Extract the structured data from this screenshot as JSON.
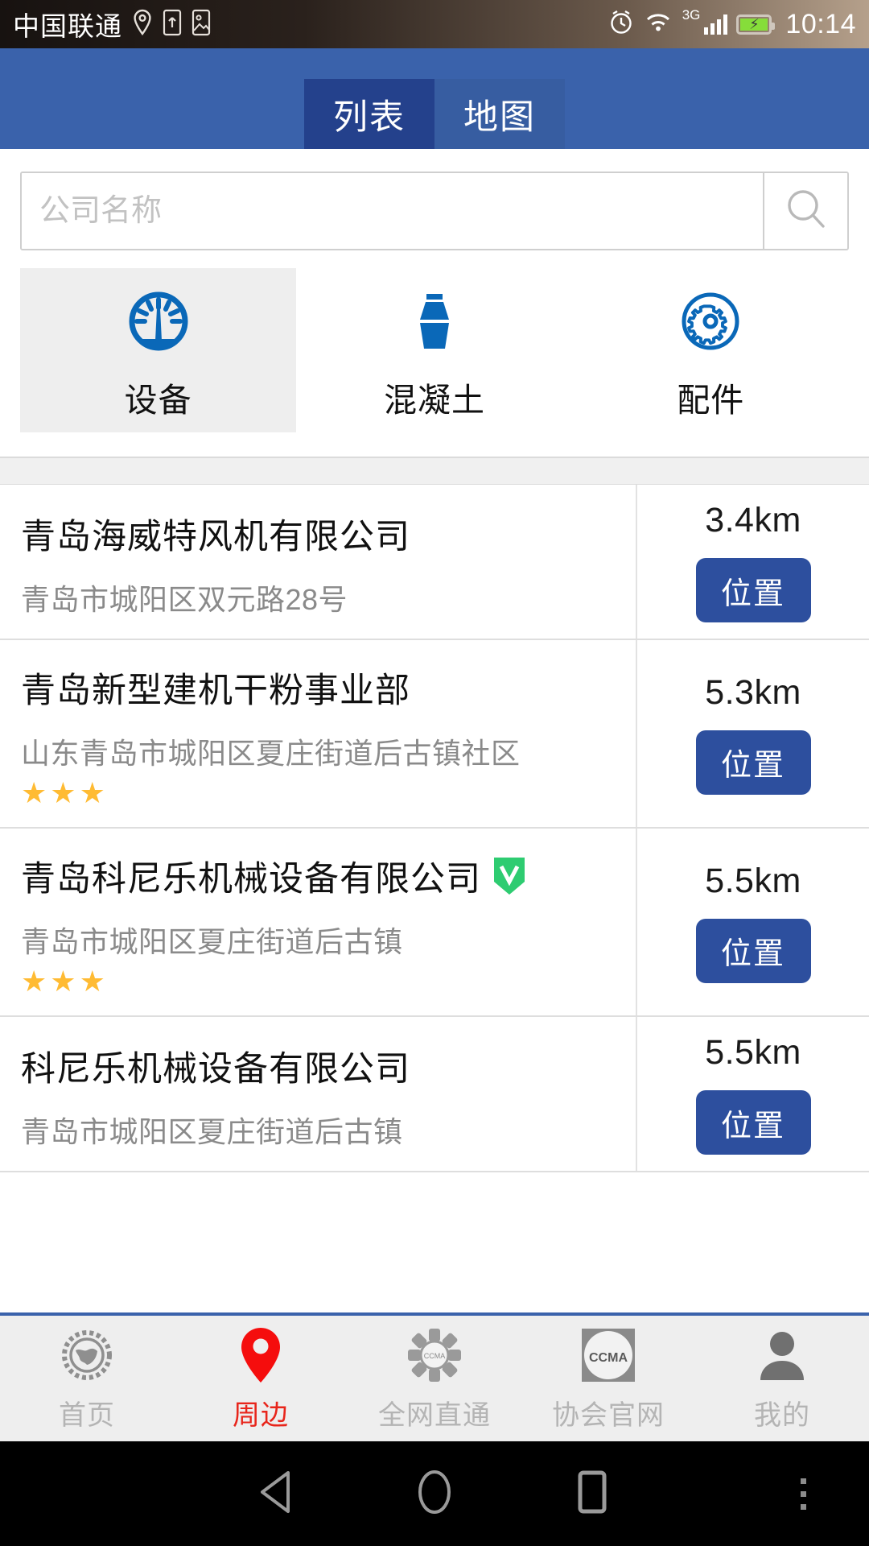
{
  "statusbar": {
    "carrier": "中国联通",
    "network": "3G",
    "time": "10:14",
    "icons": [
      "location-icon",
      "sim-icon",
      "image-icon",
      "alarm-icon",
      "wifi-icon",
      "signal-icon",
      "battery-charging-icon"
    ]
  },
  "header": {
    "tabs": [
      {
        "label": "列表",
        "selected": true
      },
      {
        "label": "地图",
        "selected": false
      }
    ]
  },
  "search": {
    "placeholder": "公司名称",
    "value": "",
    "button_icon": "search-icon"
  },
  "categories": [
    {
      "label": "设备",
      "icon": "gauge-icon",
      "selected": true
    },
    {
      "label": "混凝土",
      "icon": "concrete-mixer-icon",
      "selected": false
    },
    {
      "label": "配件",
      "icon": "gear-circle-icon",
      "selected": false
    }
  ],
  "list": {
    "action_label": "位置",
    "items": [
      {
        "name": "青岛海威特风机有限公司",
        "address": "青岛市城阳区双元路28号",
        "distance": "3.4km",
        "verified": false,
        "stars": 0
      },
      {
        "name": "青岛新型建机干粉事业部",
        "address": "山东青岛市城阳区夏庄街道后古镇社区",
        "distance": "5.3km",
        "verified": false,
        "stars": 3
      },
      {
        "name": "青岛科尼乐机械设备有限公司",
        "address": "青岛市城阳区夏庄街道后古镇",
        "distance": "5.5km",
        "verified": true,
        "stars": 3
      },
      {
        "name": "科尼乐机械设备有限公司",
        "address": "青岛市城阳区夏庄街道后古镇",
        "distance": "5.5km",
        "verified": false,
        "stars": 0
      }
    ]
  },
  "bottomnav": {
    "items": [
      {
        "label": "首页",
        "icon": "globe-gear-icon",
        "active": false
      },
      {
        "label": "周边",
        "icon": "map-pin-icon",
        "active": true
      },
      {
        "label": "全网直通",
        "icon": "gear-flower-icon",
        "active": false
      },
      {
        "label": "协会官网",
        "icon": "ccma-logo-icon",
        "active": false
      },
      {
        "label": "我的",
        "icon": "person-icon",
        "active": false
      }
    ],
    "ccma_text": "CCMA"
  },
  "androidnav": {
    "buttons": [
      "back-triangle-icon",
      "home-circle-icon",
      "recents-square-icon",
      "overflow-dots-icon"
    ]
  },
  "colors": {
    "header_blue": "#3a62ab",
    "tab_selected": "#24418c",
    "accent_blue": "#0a68b8",
    "button_blue": "#2d4f9e",
    "active_red": "#e8251b",
    "verified_green": "#2ecc71",
    "star_orange": "#ffbb33"
  }
}
